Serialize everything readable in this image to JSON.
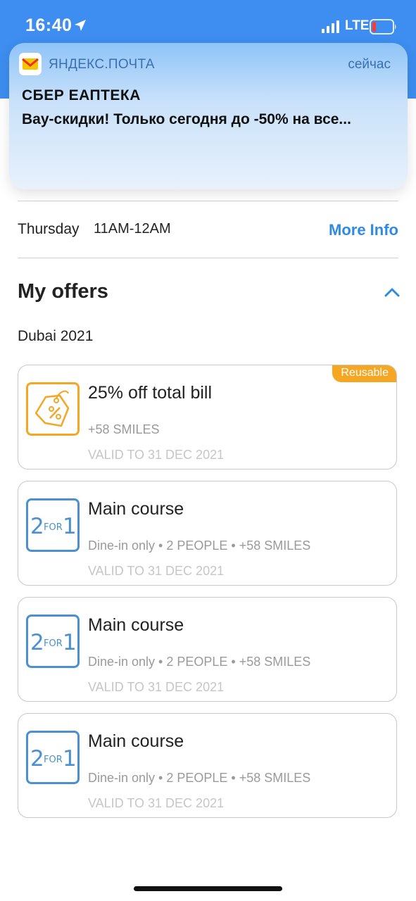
{
  "status_bar": {
    "time": "16:40",
    "network": "LTE",
    "background_color": "#3d8ef0"
  },
  "notification": {
    "app_name": "ЯНДЕКС.ПОЧТА",
    "time": "сейчас",
    "title": "СБЕР ЕАПТЕКА",
    "body": "Вау-скидки! Только сегодня до -50% на все..."
  },
  "hours": {
    "day": "Thursday",
    "time": "11AM-12AM",
    "more_info": "More Info"
  },
  "offers": {
    "title": "My offers",
    "group": "Dubai 2021",
    "items": [
      {
        "icon": "percent-tag-icon",
        "title": "25% off total bill",
        "meta": "+58 SMILES",
        "validity": "VALID TO 31 DEC 2021",
        "badge": "Reusable"
      },
      {
        "icon": "two-for-one-icon",
        "title": "Main course",
        "meta": "Dine-in only • 2 PEOPLE • +58 SMILES",
        "validity": "VALID TO 31 DEC 2021"
      },
      {
        "icon": "two-for-one-icon",
        "title": "Main course",
        "meta": "Dine-in only • 2 PEOPLE • +58 SMILES",
        "validity": "VALID TO 31 DEC 2021"
      },
      {
        "icon": "two-for-one-icon",
        "title": "Main course",
        "meta": "Dine-in only • 2 PEOPLE • +58 SMILES",
        "validity": "VALID TO 31 DEC 2021"
      }
    ]
  },
  "colors": {
    "accent": "#2f8be0",
    "badge": "#f5a623",
    "offer_icon_blue": "#4a90d2"
  }
}
